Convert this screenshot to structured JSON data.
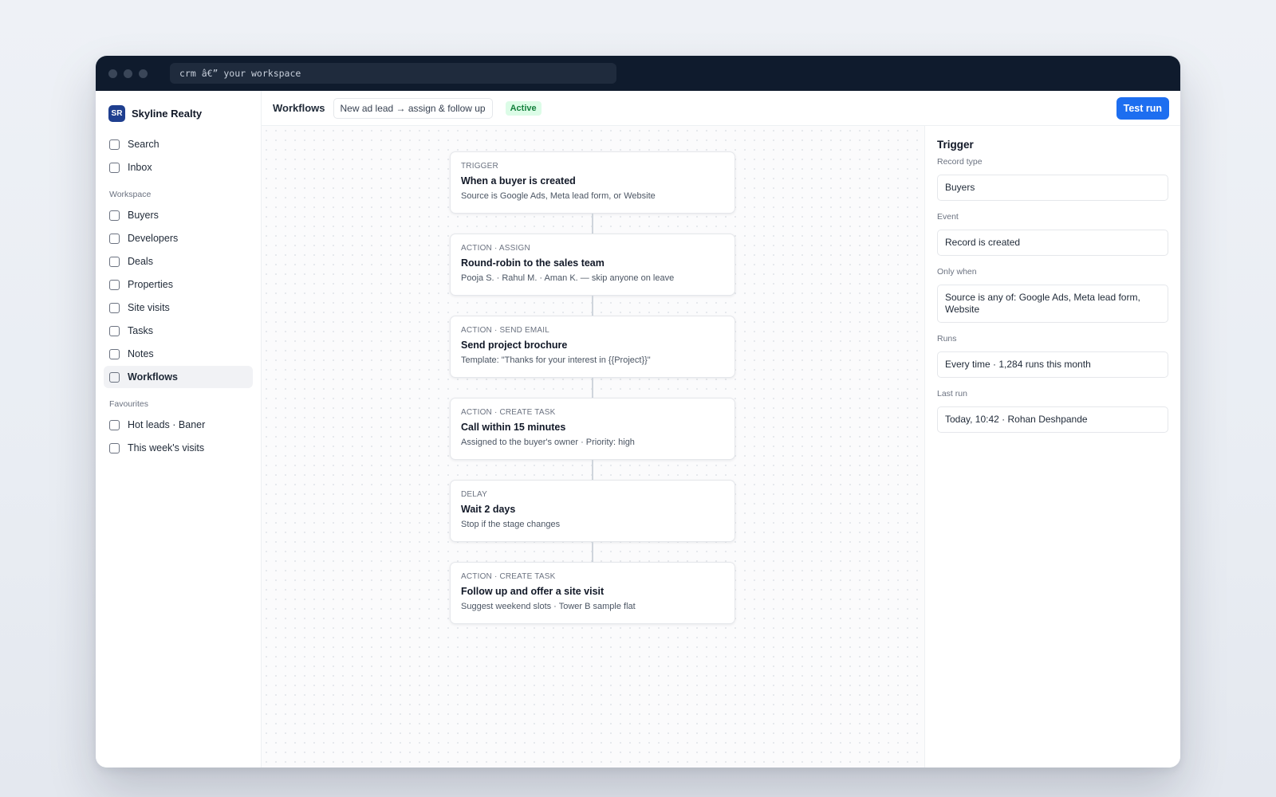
{
  "titlebar": {
    "address": "crm â€” your workspace"
  },
  "sidebar": {
    "brand_logo": "SR",
    "brand_name": "Skyline Realty",
    "top_items": [
      {
        "label": "Search"
      },
      {
        "label": "Inbox"
      }
    ],
    "workspace_label": "Workspace",
    "workspace_items": [
      {
        "label": "Buyers"
      },
      {
        "label": "Developers"
      },
      {
        "label": "Deals"
      },
      {
        "label": "Properties"
      },
      {
        "label": "Site visits"
      },
      {
        "label": "Tasks"
      },
      {
        "label": "Notes"
      },
      {
        "label": "Workflows"
      }
    ],
    "favourites_label": "Favourites",
    "favourite_items": [
      {
        "label": "Hot leads · Baner"
      },
      {
        "label": "This week's visits"
      }
    ]
  },
  "topbar": {
    "title": "Workflows",
    "workflow_name": "New ad lead → assign & follow up",
    "status": "Active",
    "test_run_label": "Test run"
  },
  "colors": {
    "accent": "#1d6ef0",
    "active_badge_bg": "#dcfce7",
    "active_badge_text": "#15803d",
    "titlebar": "#0f1b2d"
  },
  "flow": {
    "nodes": [
      {
        "kind": "TRIGGER",
        "title": "When a buyer is created",
        "desc": "Source is Google Ads, Meta lead form, or Website"
      },
      {
        "kind": "ACTION · ASSIGN",
        "title": "Round-robin to the sales team",
        "desc": "Pooja S. · Rahul M. · Aman K. — skip anyone on leave"
      },
      {
        "kind": "ACTION · SEND EMAIL",
        "title": "Send project brochure",
        "desc": "Template: \"Thanks for your interest in {{Project}}\""
      },
      {
        "kind": "ACTION · CREATE TASK",
        "title": "Call within 15 minutes",
        "desc": "Assigned to the buyer's owner · Priority: high"
      },
      {
        "kind": "DELAY",
        "title": "Wait 2 days",
        "desc": "Stop if the stage changes"
      },
      {
        "kind": "ACTION · CREATE TASK",
        "title": "Follow up and offer a site visit",
        "desc": "Suggest weekend slots · Tower B sample flat"
      }
    ]
  },
  "panel": {
    "title": "Trigger",
    "fields": [
      {
        "label": "Record type",
        "value": "Buyers"
      },
      {
        "label": "Event",
        "value": "Record is created"
      },
      {
        "label": "Only when",
        "value": "Source is any of: Google Ads, Meta lead form, Website"
      },
      {
        "label": "Runs",
        "value": "Every time · 1,284 runs this month"
      },
      {
        "label": "Last run",
        "value": "Today, 10:42 · Rohan Deshpande"
      }
    ]
  }
}
